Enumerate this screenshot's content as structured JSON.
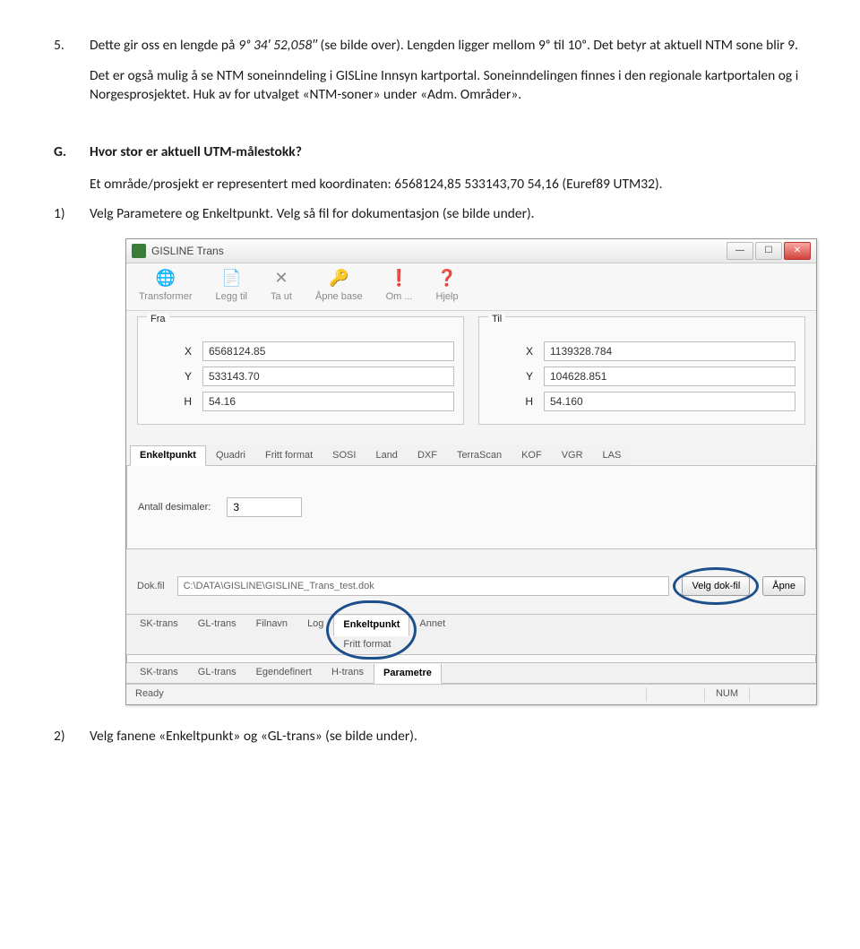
{
  "doc": {
    "item5_num": "5.",
    "item5_text_a": "Dette gir oss en lengde på ",
    "item5_text_len": "9ᵒ 34′ 52,058′′",
    "item5_text_b": " (se bilde over). Lengden ligger mellom 9ᵒ til 10ᵒ. Det betyr at aktuell NTM sone blir 9.",
    "item5_para2": "Det er også mulig å se NTM soneinndeling i GISLine Innsyn kartportal. Soneinndelingen finnes i den regionale kartportalen og i Norgesprosjektet. Huk av for utvalget «NTM-soner» under «Adm. Områder».",
    "sectG_num": "G.",
    "sectG_title": "Hvor stor er aktuell UTM-målestokk?",
    "sectG_text": "Et område/prosjekt er representert med koordinaten: 6568124,85 533143,70 54,16 (Euref89 UTM32).",
    "step1_num": "1)",
    "step1_text": "Velg Parametere og Enkeltpunkt. Velg så fil for dokumentasjon (se bilde under).",
    "step2_num": "2)",
    "step2_text": "Velg fanene «Enkeltpunkt» og «GL-trans» (se bilde under)."
  },
  "app": {
    "title": "GISLINE Trans",
    "toolbar": {
      "transformer": "Transformer",
      "legg_til": "Legg til",
      "ta_ut": "Ta ut",
      "apne_base": "Åpne base",
      "om": "Om ...",
      "hjelp": "Hjelp"
    },
    "from_label": "Fra",
    "to_label": "Til",
    "labels": {
      "x": "X",
      "y": "Y",
      "h": "H"
    },
    "from": {
      "x": "6568124.85",
      "y": "533143.70",
      "h": "54.16"
    },
    "to": {
      "x": "1139328.784",
      "y": "104628.851",
      "h": "54.160"
    },
    "tabs1": [
      "Enkeltpunkt",
      "Quadri",
      "Fritt format",
      "SOSI",
      "Land",
      "DXF",
      "TerraScan",
      "KOF",
      "VGR",
      "LAS"
    ],
    "tabs1_active": 0,
    "decimals_label": "Antall desimaler:",
    "decimals_value": "3",
    "dok_label": "Dok.fil",
    "dok_path": "C:\\DATA\\GISLINE\\GISLINE_Trans_test.dok",
    "btn_velg_dok": "Velg dok-fil",
    "btn_apne": "Åpne",
    "tabs2": [
      "SK-trans",
      "GL-trans",
      "Filnavn",
      "Log",
      "Enkeltpunkt",
      "Fritt format",
      "Annet"
    ],
    "tabs2_active": 4,
    "tabs3": [
      "SK-trans",
      "GL-trans",
      "Egendefinert",
      "H-trans",
      "Parametre"
    ],
    "tabs3_active": 4,
    "status_ready": "Ready",
    "status_num": "NUM"
  }
}
